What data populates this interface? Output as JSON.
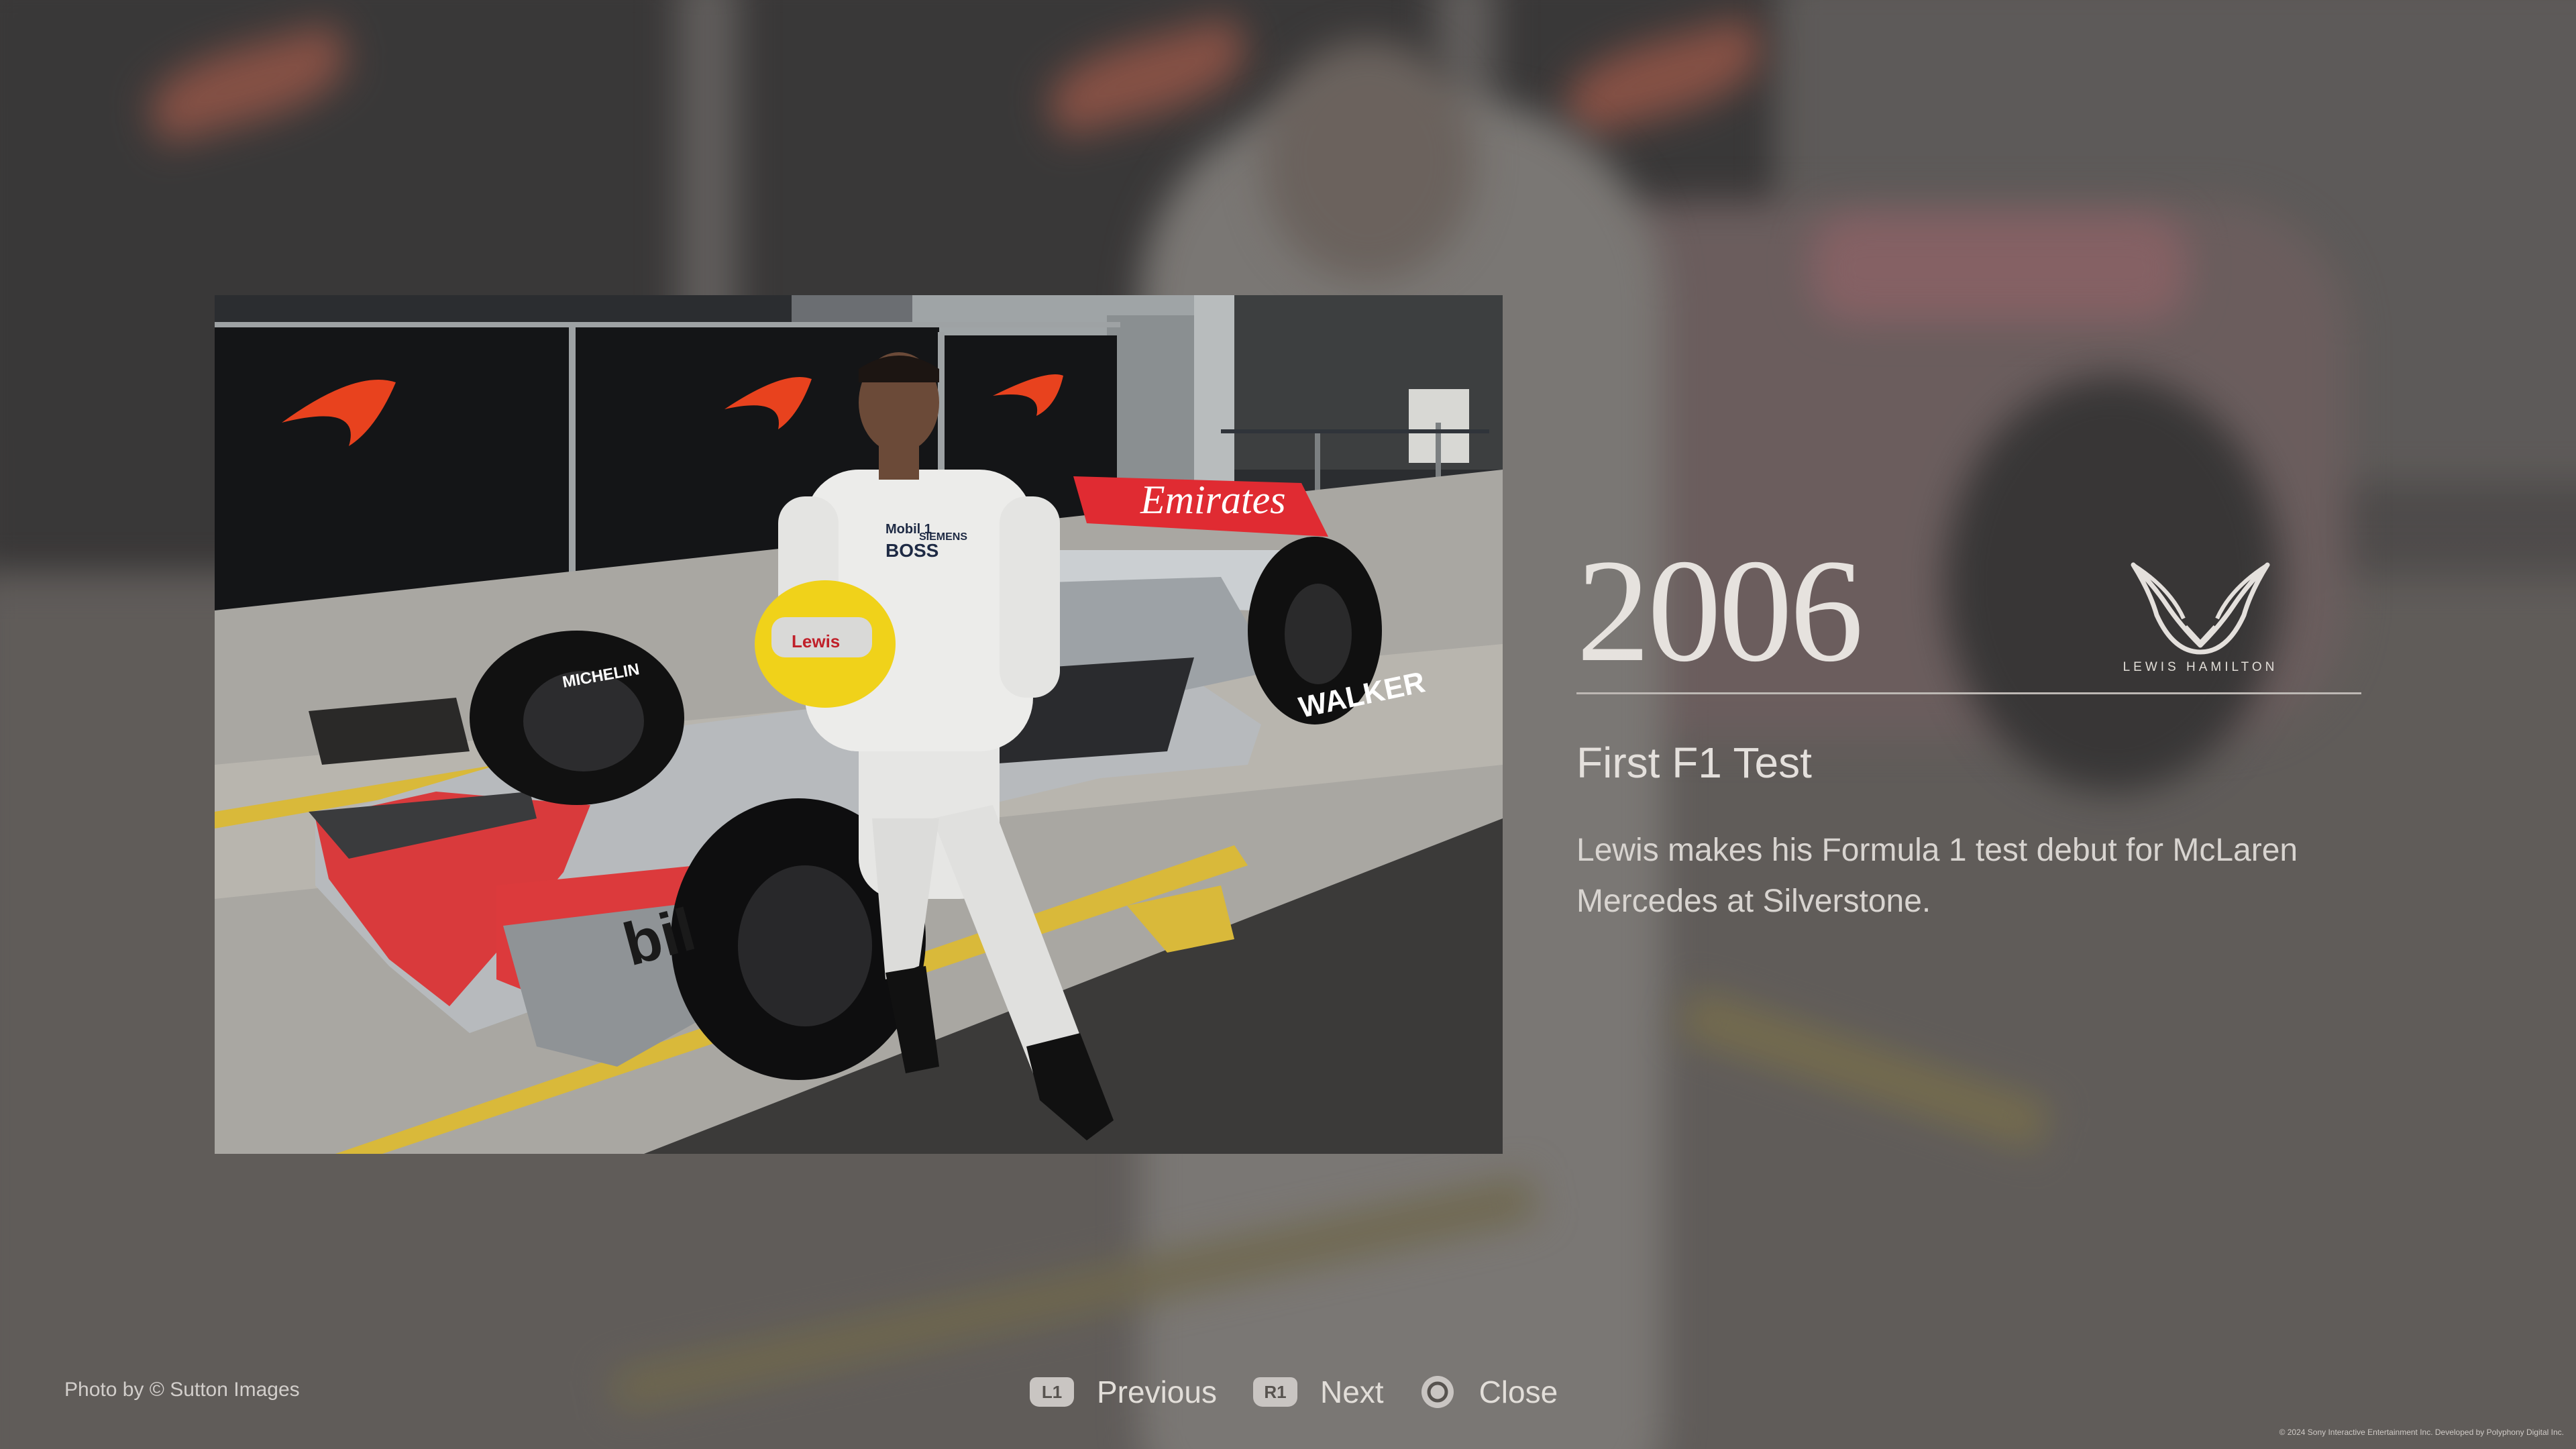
{
  "entry": {
    "year": "2006",
    "brand_text": "LEWIS HAMILTON",
    "headline": "First F1 Test",
    "description": "Lewis makes his Formula 1 test debut for McLaren Mercedes at Silverstone.",
    "photo_credit": "Photo by © Sutton Images"
  },
  "photo_text": {
    "sponsor_emirates": "Emirates",
    "sponsor_boss": "BOSS",
    "sponsor_mobil": "Mobil 1",
    "sponsor_siemens": "SIEMENS",
    "sponsor_walker": "WALKER",
    "sponsor_michelin": "MICHELIN",
    "sponsor_bil": "bil",
    "helmet_lewis": "Lewis"
  },
  "controls": {
    "previous": {
      "badge": "L1",
      "label": "Previous"
    },
    "next": {
      "badge": "R1",
      "label": "Next"
    },
    "close": {
      "icon": "circle-button-icon",
      "label": "Close"
    }
  },
  "legal": "© 2024 Sony Interactive Entertainment Inc. Developed by Polyphony Digital Inc.",
  "colors": {
    "accent_red": "#e23a2e",
    "mclaren_orange": "#e8421e",
    "text_light": "#e4e0dc"
  }
}
